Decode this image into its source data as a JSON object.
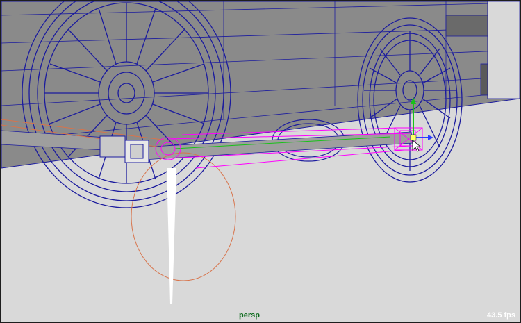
{
  "viewport": {
    "camera_name": "persp",
    "fps_text": "43.5 fps"
  },
  "colors": {
    "ground": "#d9d9d9",
    "body_panel": "#8a8a8a",
    "wire": "#1b1b9e",
    "selection": "#ff00ff",
    "pivot_orange": "#d8734a",
    "manip_y": "#17c217",
    "manip_z": "#2a3cff",
    "camera_label": "#0c6a1c",
    "fps_label": "#ffffff"
  }
}
